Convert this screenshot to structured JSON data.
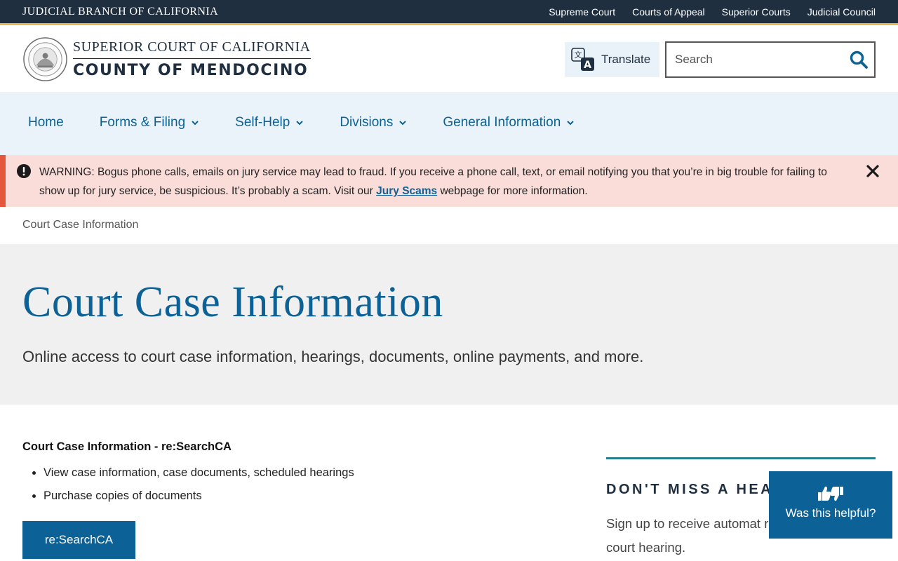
{
  "topbar": {
    "brand": "JUDICIAL BRANCH OF CALIFORNIA",
    "links": [
      "Supreme Court",
      "Courts of Appeal",
      "Superior Courts",
      "Judicial Council"
    ]
  },
  "header": {
    "court_line1": "SUPERIOR COURT OF CALIFORNIA",
    "court_line2": "COUNTY OF MENDOCINO",
    "translate_label": "Translate",
    "search_placeholder": "Search"
  },
  "nav": {
    "items": [
      {
        "label": "Home"
      },
      {
        "label": "Forms & Filing"
      },
      {
        "label": "Self-Help"
      },
      {
        "label": "Divisions"
      },
      {
        "label": "General Information"
      }
    ]
  },
  "alert": {
    "text_before": "WARNING: Bogus phone calls, emails on jury service may lead to fraud.  If you receive a phone call, text, or email notifying you that you’re in big trouble for failing to show up for jury service, be suspicious.  It’s probably a scam.  Visit our ",
    "link_text": "Jury Scams",
    "text_after": " webpage for more information."
  },
  "breadcrumb": "Court Case Information",
  "hero": {
    "title": "Court Case Information",
    "subtitle": "Online access to court case information, hearings, documents, online payments, and more."
  },
  "main": {
    "section_title": "Court Case Information  - re:SearchCA",
    "bullets": [
      "View case information, case documents, scheduled hearings",
      "Purchase copies of documents"
    ],
    "cta_label": "re:SearchCA"
  },
  "sidebar": {
    "title": "DON'T MISS A HEA",
    "text": "Sign up to receive automat reminders for your court hearing."
  },
  "feedback": {
    "label": "Was this helpful?"
  },
  "colors": {
    "dark_navy": "#1f2f40",
    "brand_blue": "#0c6296",
    "gold_accent": "#e8b84a",
    "alert_bg": "#fadcd9",
    "alert_border": "#e4573d",
    "nav_bg": "#ebf3fa",
    "hero_bg": "#f0f0f0",
    "teal_rule": "#2a7f8f"
  }
}
